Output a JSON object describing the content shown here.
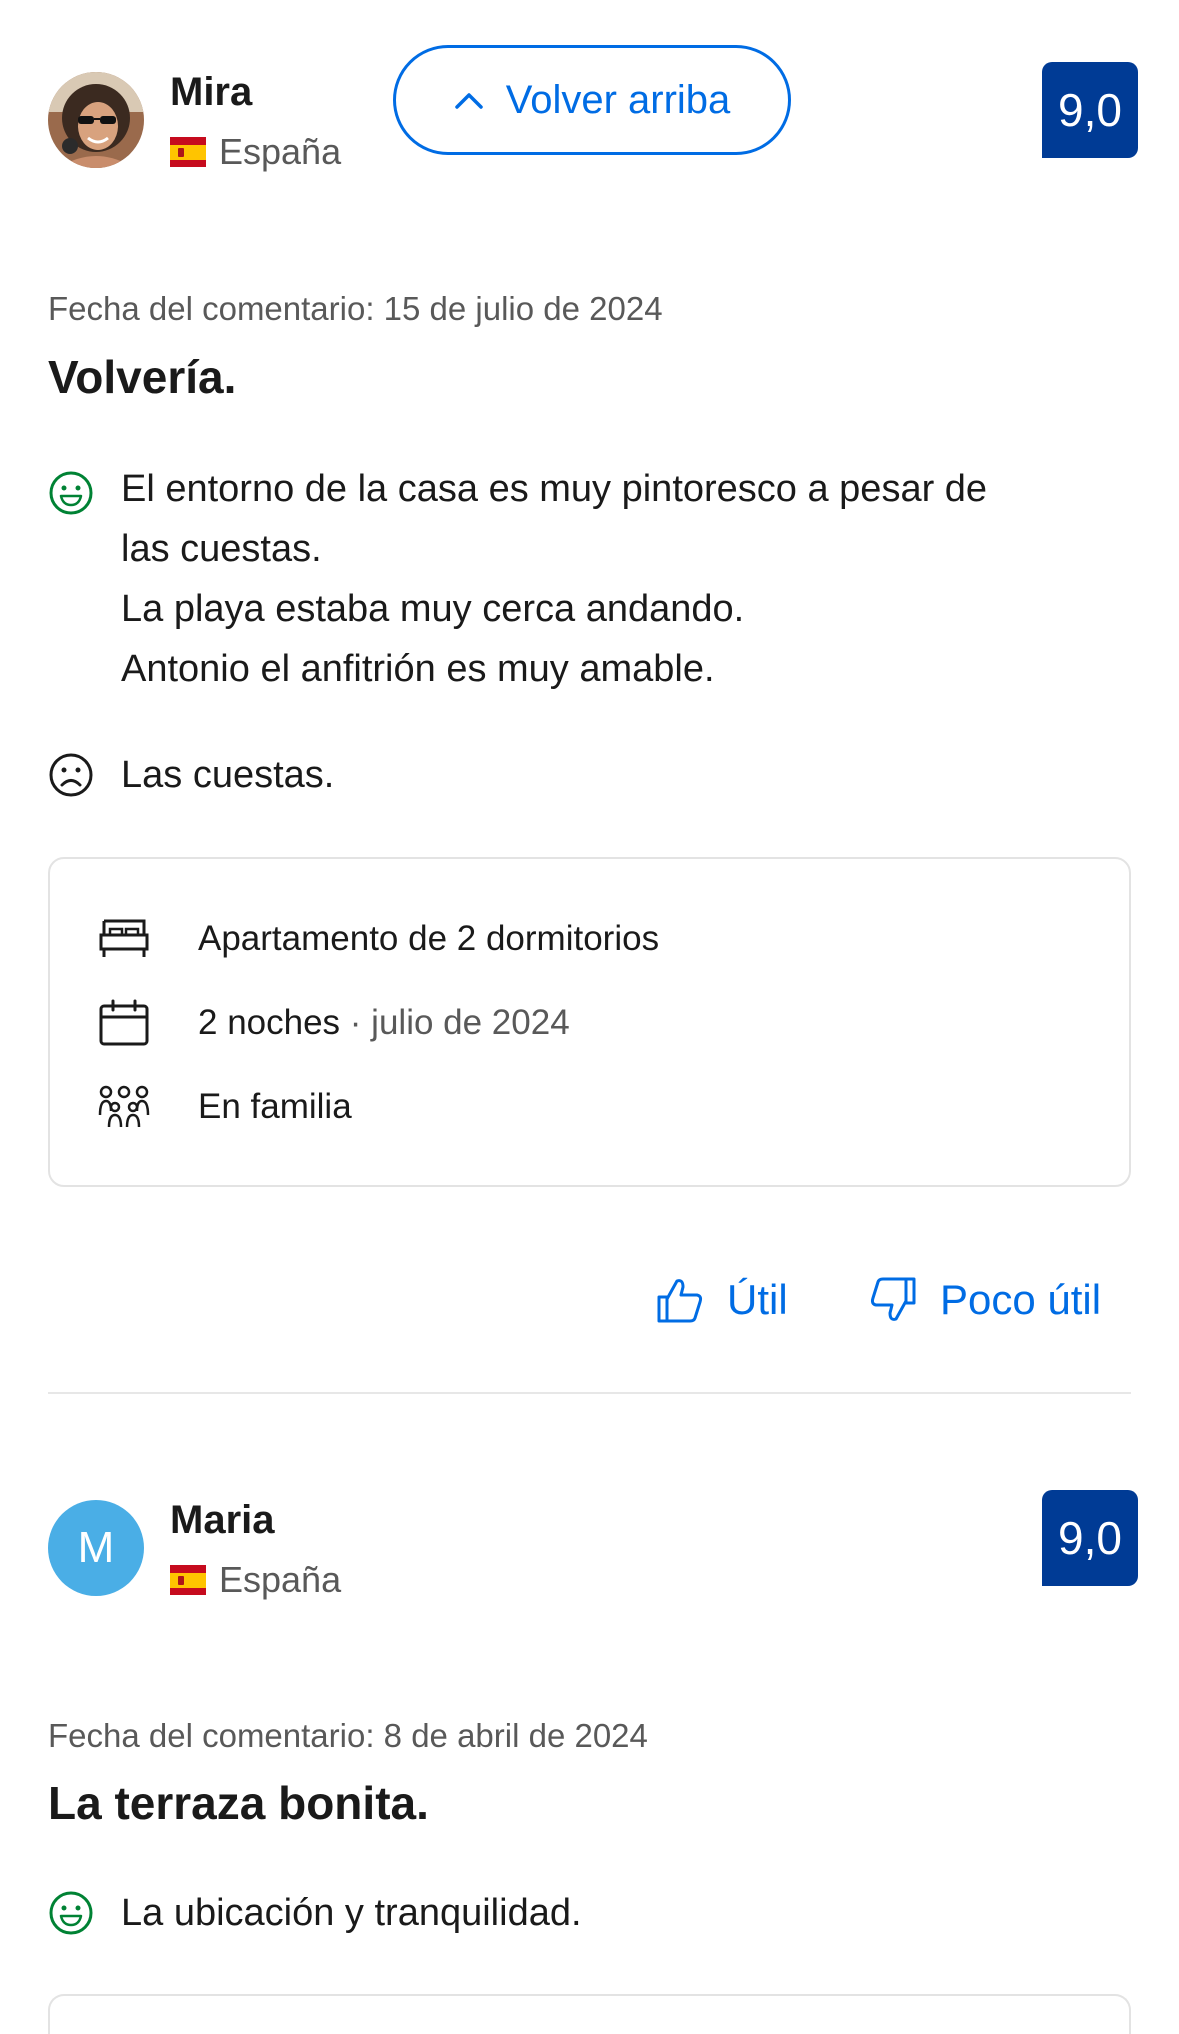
{
  "back_to_top": {
    "label": "Volver arriba"
  },
  "reviews": [
    {
      "reviewer": {
        "name": "Mira",
        "country": "España",
        "avatar": "photo"
      },
      "score": "9,0",
      "date": "Fecha del comentario: 15 de julio de 2024",
      "title": "Volvería.",
      "positive_lines": [
        "El entorno de la casa es muy pintoresco a pesar de",
        "las cuestas.",
        "La playa estaba muy cerca andando.",
        "Antonio el anfitrión es muy amable."
      ],
      "negative_lines": [
        "Las cuestas."
      ],
      "stay": {
        "room": "Apartamento de 2 dormitorios",
        "nights": "2 noches",
        "separator": " · ",
        "month": "julio de 2024",
        "traveler_type": "En familia"
      },
      "helpful": {
        "yes_label": "Útil",
        "no_label": "Poco útil"
      }
    },
    {
      "reviewer": {
        "name": "Maria",
        "country": "España",
        "avatar_letter": "M"
      },
      "score": "9,0",
      "date": "Fecha del comentario: 8 de abril de 2024",
      "title": "La terraza bonita.",
      "positive_lines": [
        "La ubicación y tranquilidad."
      ]
    }
  ],
  "colors": {
    "brand_blue": "#003b95",
    "link_blue": "#006ce4",
    "positive_green": "#008234",
    "avatar_blue": "#4aaee6",
    "muted_text": "#595959"
  },
  "icons": {
    "back_to_top": "chevron-up-icon",
    "positive": "smile-icon",
    "negative": "frown-icon",
    "room": "bed-icon",
    "dates": "calendar-icon",
    "traveler": "family-icon",
    "helpful": "thumbs-up-icon",
    "not_helpful": "thumbs-down-icon"
  }
}
